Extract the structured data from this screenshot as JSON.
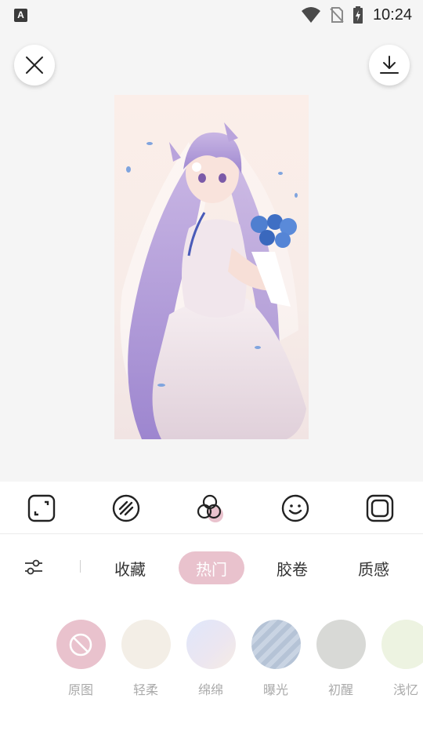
{
  "status_bar": {
    "app_badge": "A",
    "time": "10:24"
  },
  "top_actions": {
    "close_icon": "close-icon",
    "download_icon": "download-icon"
  },
  "preview": {
    "subject": "anime-bride-illustration"
  },
  "tools": [
    {
      "icon": "crop-icon"
    },
    {
      "icon": "diagonal-lines-icon"
    },
    {
      "icon": "filter-circles-icon",
      "active": true
    },
    {
      "icon": "smiley-icon"
    },
    {
      "icon": "frame-icon"
    }
  ],
  "categories": {
    "adjust_icon": "sliders-icon",
    "tabs": [
      {
        "label": "收藏"
      },
      {
        "label": "热门",
        "active": true
      },
      {
        "label": "胶卷"
      },
      {
        "label": "质感"
      }
    ]
  },
  "filters": [
    {
      "label": "原图",
      "color": "#e9c2cd",
      "icon": "none-icon"
    },
    {
      "label": "轻柔",
      "color": "#f3eee6"
    },
    {
      "label": "绵绵",
      "color": "#e4e8f6"
    },
    {
      "label": "曝光",
      "color": "#bfcbdb"
    },
    {
      "label": "初醒",
      "color": "#d8d9d6"
    },
    {
      "label": "浅忆",
      "color": "#edf3e1"
    }
  ],
  "colors": {
    "accent_pink": "#e9c2cd",
    "panel_bg": "#ffffff",
    "page_bg": "#f5f5f5"
  }
}
